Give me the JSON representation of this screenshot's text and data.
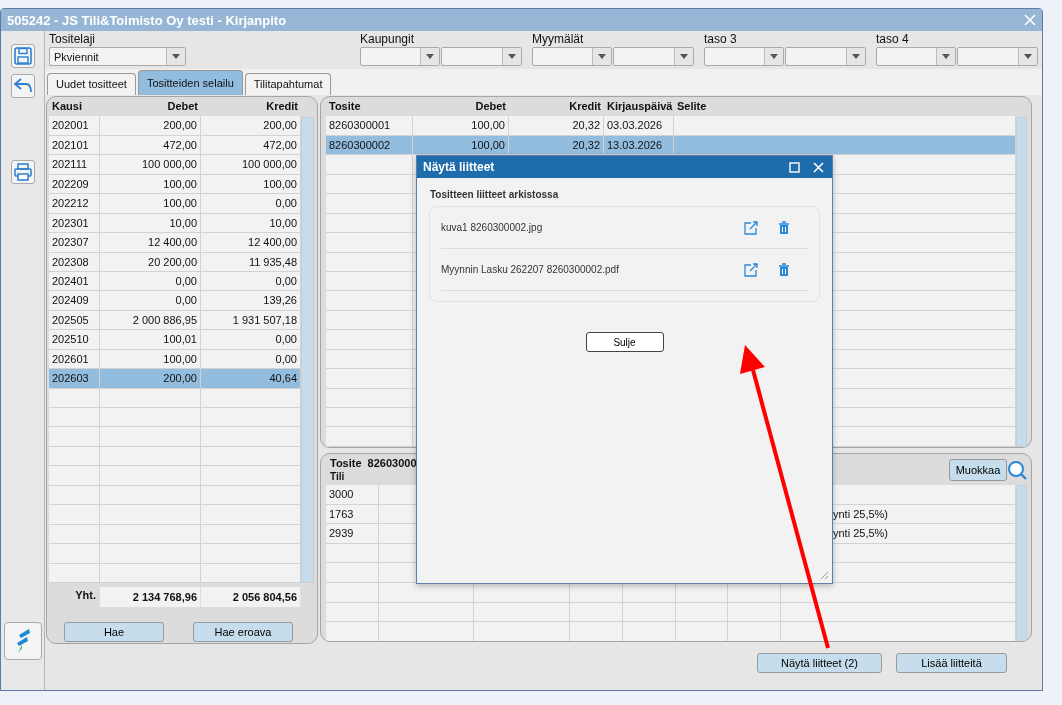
{
  "window": {
    "title": "505242 - JS Tili&Toimisto Oy testi - Kirjanpito"
  },
  "filters": [
    {
      "label": "Tositelaji",
      "kind": "single",
      "value": "Pkviennit"
    },
    {
      "label": "Kaupungit",
      "kind": "pair"
    },
    {
      "label": "Myymälät",
      "kind": "pair"
    },
    {
      "label": "taso 3",
      "kind": "pair"
    },
    {
      "label": "taso 4",
      "kind": "pair"
    }
  ],
  "tabs": [
    {
      "label": "Uudet tositteet",
      "selected": false
    },
    {
      "label": "Tositteiden selailu",
      "selected": true
    },
    {
      "label": "Tilitapahtumat",
      "selected": false
    }
  ],
  "periods": {
    "columns": [
      "Kausi",
      "Debet",
      "Kredit"
    ],
    "rows": [
      {
        "cells": [
          "202001",
          "200,00",
          "200,00"
        ],
        "selected": false
      },
      {
        "cells": [
          "202101",
          "472,00",
          "472,00"
        ],
        "selected": false
      },
      {
        "cells": [
          "202111",
          "100 000,00",
          "100 000,00"
        ],
        "selected": false
      },
      {
        "cells": [
          "202209",
          "100,00",
          "100,00"
        ],
        "selected": false
      },
      {
        "cells": [
          "202212",
          "100,00",
          "0,00"
        ],
        "selected": false
      },
      {
        "cells": [
          "202301",
          "10,00",
          "10,00"
        ],
        "selected": false
      },
      {
        "cells": [
          "202307",
          "12 400,00",
          "12 400,00"
        ],
        "selected": false
      },
      {
        "cells": [
          "202308",
          "20 200,00",
          "11 935,48"
        ],
        "selected": false
      },
      {
        "cells": [
          "202401",
          "0,00",
          "0,00"
        ],
        "selected": false
      },
      {
        "cells": [
          "202409",
          "0,00",
          "139,26"
        ],
        "selected": false
      },
      {
        "cells": [
          "202505",
          "2 000 886,95",
          "1 931 507,18"
        ],
        "selected": false
      },
      {
        "cells": [
          "202510",
          "100,01",
          "0,00"
        ],
        "selected": false
      },
      {
        "cells": [
          "202601",
          "100,00",
          "0,00"
        ],
        "selected": false
      },
      {
        "cells": [
          "202603",
          "200,00",
          "40,64"
        ],
        "selected": true
      }
    ],
    "totals": {
      "label": "Yht.",
      "debet": "2 134 768,96",
      "kredit": "2 056 804,56"
    },
    "buttons": [
      "Hae",
      "Hae eroava"
    ]
  },
  "vouchers": {
    "columns": [
      "Tosite",
      "Debet",
      "Kredit",
      "Kirjauspäivä",
      "Selite"
    ],
    "rows": [
      {
        "cells": [
          "8260300001",
          "100,00",
          "20,32",
          "03.03.2026"
        ],
        "selected": false
      },
      {
        "cells": [
          "8260300002",
          "100,00",
          "20,32",
          "13.03.2026"
        ],
        "selected": true
      }
    ]
  },
  "entries": {
    "voucher_label": "Tosite",
    "voucher_value": "82603000",
    "account_label": "Tili",
    "edit_button": "Muokkaa",
    "rows": [
      {
        "account": "3000"
      },
      {
        "account": "1763",
        "column_8": "ynti 25,5%)"
      },
      {
        "account": "2939",
        "column_8": "ynti 25,5%)"
      }
    ]
  },
  "bottom_buttons": [
    "Näytä liitteet (2)",
    "Lisää liitteitä"
  ],
  "dialog": {
    "title": "Näytä liitteet",
    "heading": "Tositteen liitteet arkistossa",
    "attachments": [
      {
        "name": "kuva1 8260300002.jpg"
      },
      {
        "name": "Myynnin Lasku 262207 8260300002.pdf"
      }
    ],
    "close_button": "Sulje"
  }
}
